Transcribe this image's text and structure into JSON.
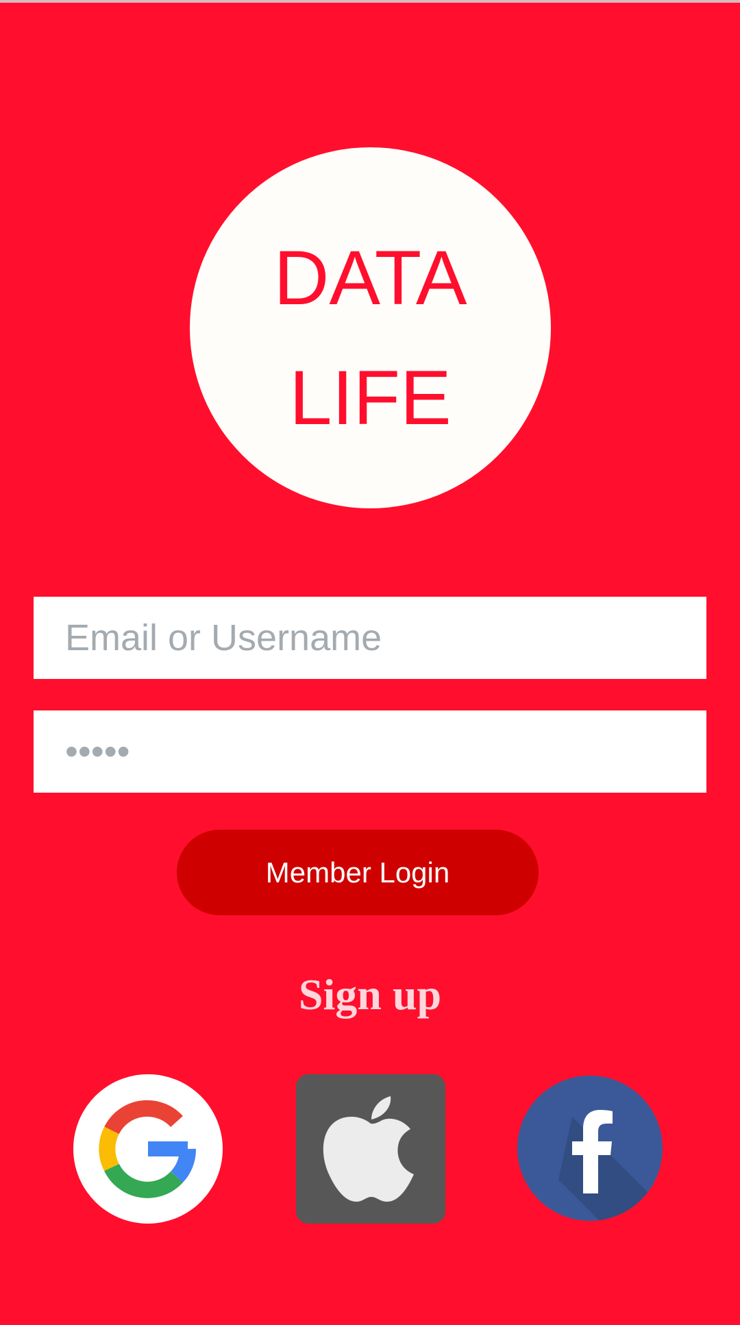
{
  "logo": {
    "line1": "DATA",
    "line2": "LIFE"
  },
  "login_form": {
    "email_placeholder": "Email or Username",
    "password_placeholder": "•••••",
    "login_button_label": "Member Login"
  },
  "signup": {
    "label": "Sign up"
  },
  "social_login": {
    "providers": [
      "google-icon",
      "apple-icon",
      "facebook-icon"
    ]
  },
  "colors": {
    "background": "#ff0f2d",
    "button": "#cf0000",
    "logo_circle": "#fffdfa",
    "facebook": "#3b5998",
    "apple_tile": "#575757"
  }
}
